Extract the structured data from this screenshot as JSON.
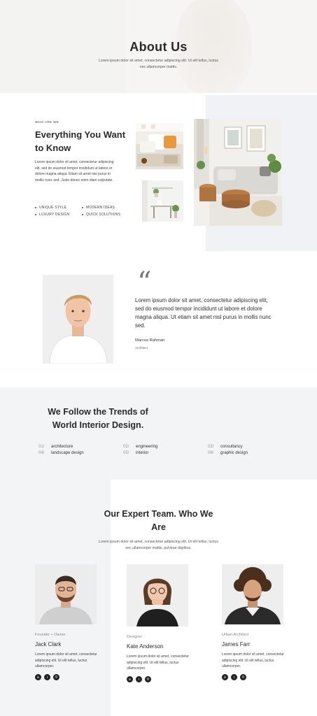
{
  "hero": {
    "title": "About Us",
    "text": "Lorem ipsum dolor sit amet, consectetur adipiscing elit. Ut elit tellus, luctus nec ullamcorper mattis."
  },
  "about": {
    "eyebrow": "WHO ARE WE",
    "title": "Everything You Want to Know",
    "text": "Lorem ipsum dolor sit amet, consectetur adipiscing elit, sed do eiusmod tempor incididunt ut labore et dolore magna aliqua. Etiam sit amet nisl purus in mollis nunc sed. Justo donec enim diam vulputate.",
    "features": [
      "UNIQUE STYLE",
      "MODERN IDEAS",
      "LUXURY DESIGN",
      "QUICK SOLUTIONS"
    ]
  },
  "testimonial": {
    "quote_mark": "“",
    "text": "Lorem ipsum dolor sit amet, consectetur adipiscing elit, sed do eiusmod tempor incididunt ut labore et dolore magna aliqua. Ut etiam sit amet nisl purus in mollis nunc sed.",
    "name": "Marcus Rahman",
    "role": "Architect"
  },
  "trends": {
    "title": "We Follow the Trends of World Interior Design.",
    "items": [
      {
        "num": "01/",
        "label": "architecture"
      },
      {
        "num": "02/",
        "label": "engineering"
      },
      {
        "num": "03/",
        "label": "consultancy"
      },
      {
        "num": "04/",
        "label": "landscape design"
      },
      {
        "num": "05/",
        "label": "interior"
      },
      {
        "num": "06/",
        "label": "graphic design"
      }
    ]
  },
  "team": {
    "title": "Our Expert Team. Who We Are",
    "text": "Lorem ipsum dolor sit amet, consectetur adipiscing elit. Ut elit tellus, luctus nec ullamcorper mattis, pulvinar dapibus.",
    "members": [
      {
        "role": "Founder + Owner",
        "name": "Jack Clark",
        "bio": "Lorem ipsum dolor sit amet, consectetur adipiscing elit. Ut elit tellus, luctus ullamcorper."
      },
      {
        "role": "Designer",
        "name": "Kate Anderson",
        "bio": "Lorem ipsum dolor sit amet, consectetur adipiscing elit. Ut elit tellus, luctus ullamcorper."
      },
      {
        "role": "Urban Architect",
        "name": "James Farr",
        "bio": "Lorem ipsum dolor sit amet, consectetur adipiscing elit. Ut elit tellus, luctus ullamcorper."
      }
    ],
    "social_icons": [
      "linkedin-icon",
      "twitter-icon",
      "instagram-icon"
    ]
  }
}
